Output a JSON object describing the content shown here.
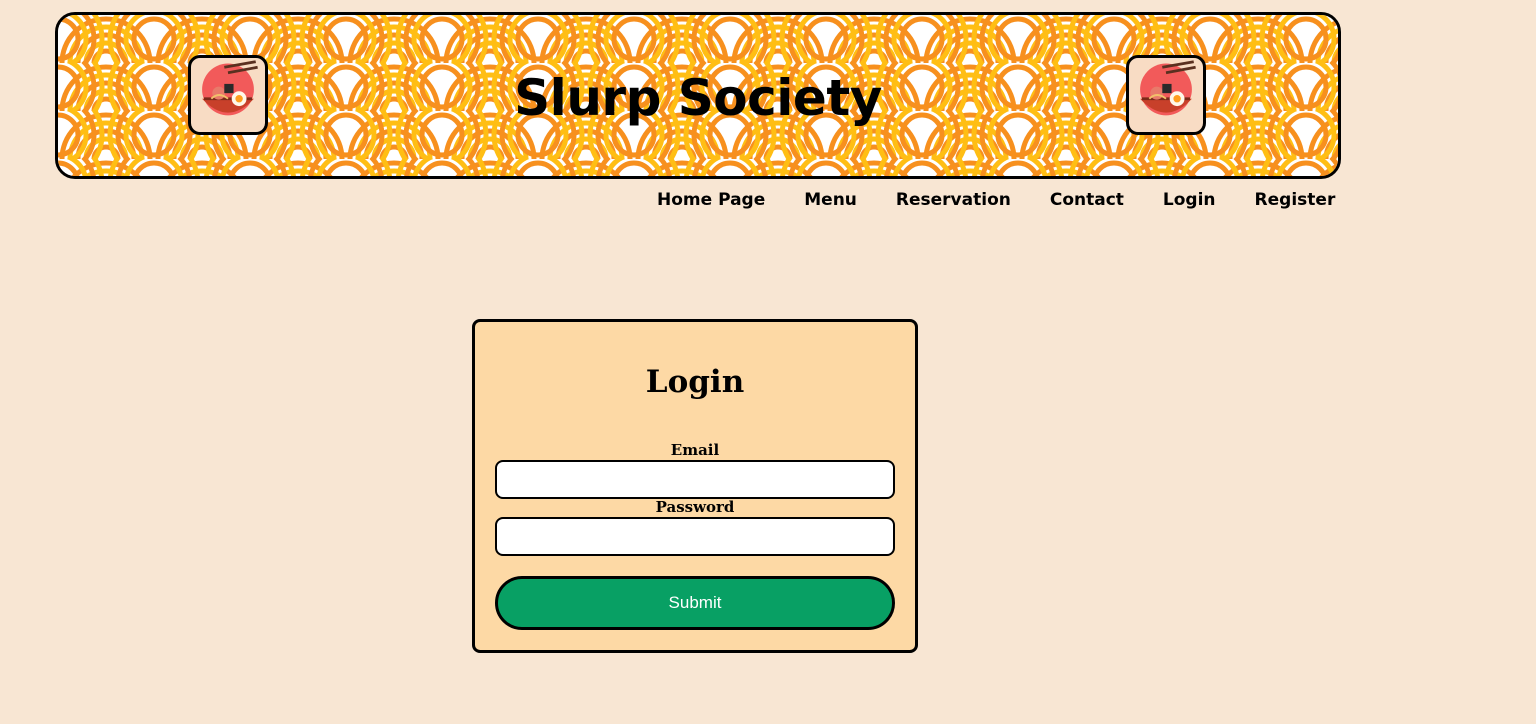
{
  "header": {
    "title": "Slurp Society",
    "logo_icon": "ramen-bowl-icon",
    "pattern_colors": [
      "#f7901e",
      "#ffbe14",
      "#ffffff"
    ]
  },
  "nav": {
    "items": [
      {
        "label": "Home Page"
      },
      {
        "label": "Menu"
      },
      {
        "label": "Reservation"
      },
      {
        "label": "Contact"
      },
      {
        "label": "Login"
      },
      {
        "label": "Register"
      }
    ]
  },
  "login_form": {
    "title": "Login",
    "email_label": "Email",
    "email_value": "",
    "password_label": "Password",
    "password_value": "",
    "submit_label": "Submit"
  },
  "colors": {
    "page_background": "#f8e6d3",
    "card_background": "#fdd9a5",
    "submit_background": "#08a064",
    "accent_orange": "#f7901e",
    "accent_yellow": "#ffbe14"
  }
}
